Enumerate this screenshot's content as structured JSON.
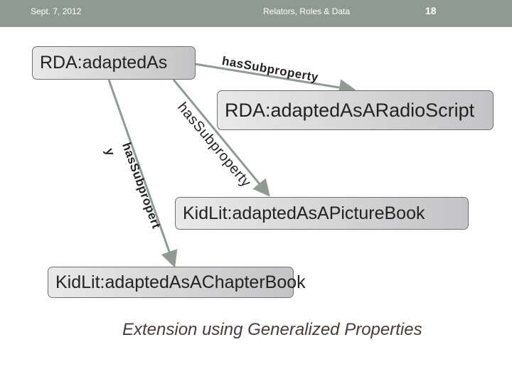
{
  "header": {
    "date": "Sept. 7, 2012",
    "title": "Relators, Roles & Data",
    "page": "18"
  },
  "nodes": {
    "root": "RDA:adaptedAs",
    "radio": "RDA:adaptedAsARadioScript",
    "picture": "KidLit:adaptedAsAPictureBook",
    "chapter": "KidLit:adaptedAsAChapterBook"
  },
  "edges": {
    "top": "hasSubproperty",
    "middle": "hasSubproperty",
    "left_a": "hasSubpropert",
    "left_b": "y"
  },
  "caption": "Extension using Generalized Properties",
  "colors": {
    "header": "#8f9b92",
    "arrow": "#8f9b92"
  }
}
